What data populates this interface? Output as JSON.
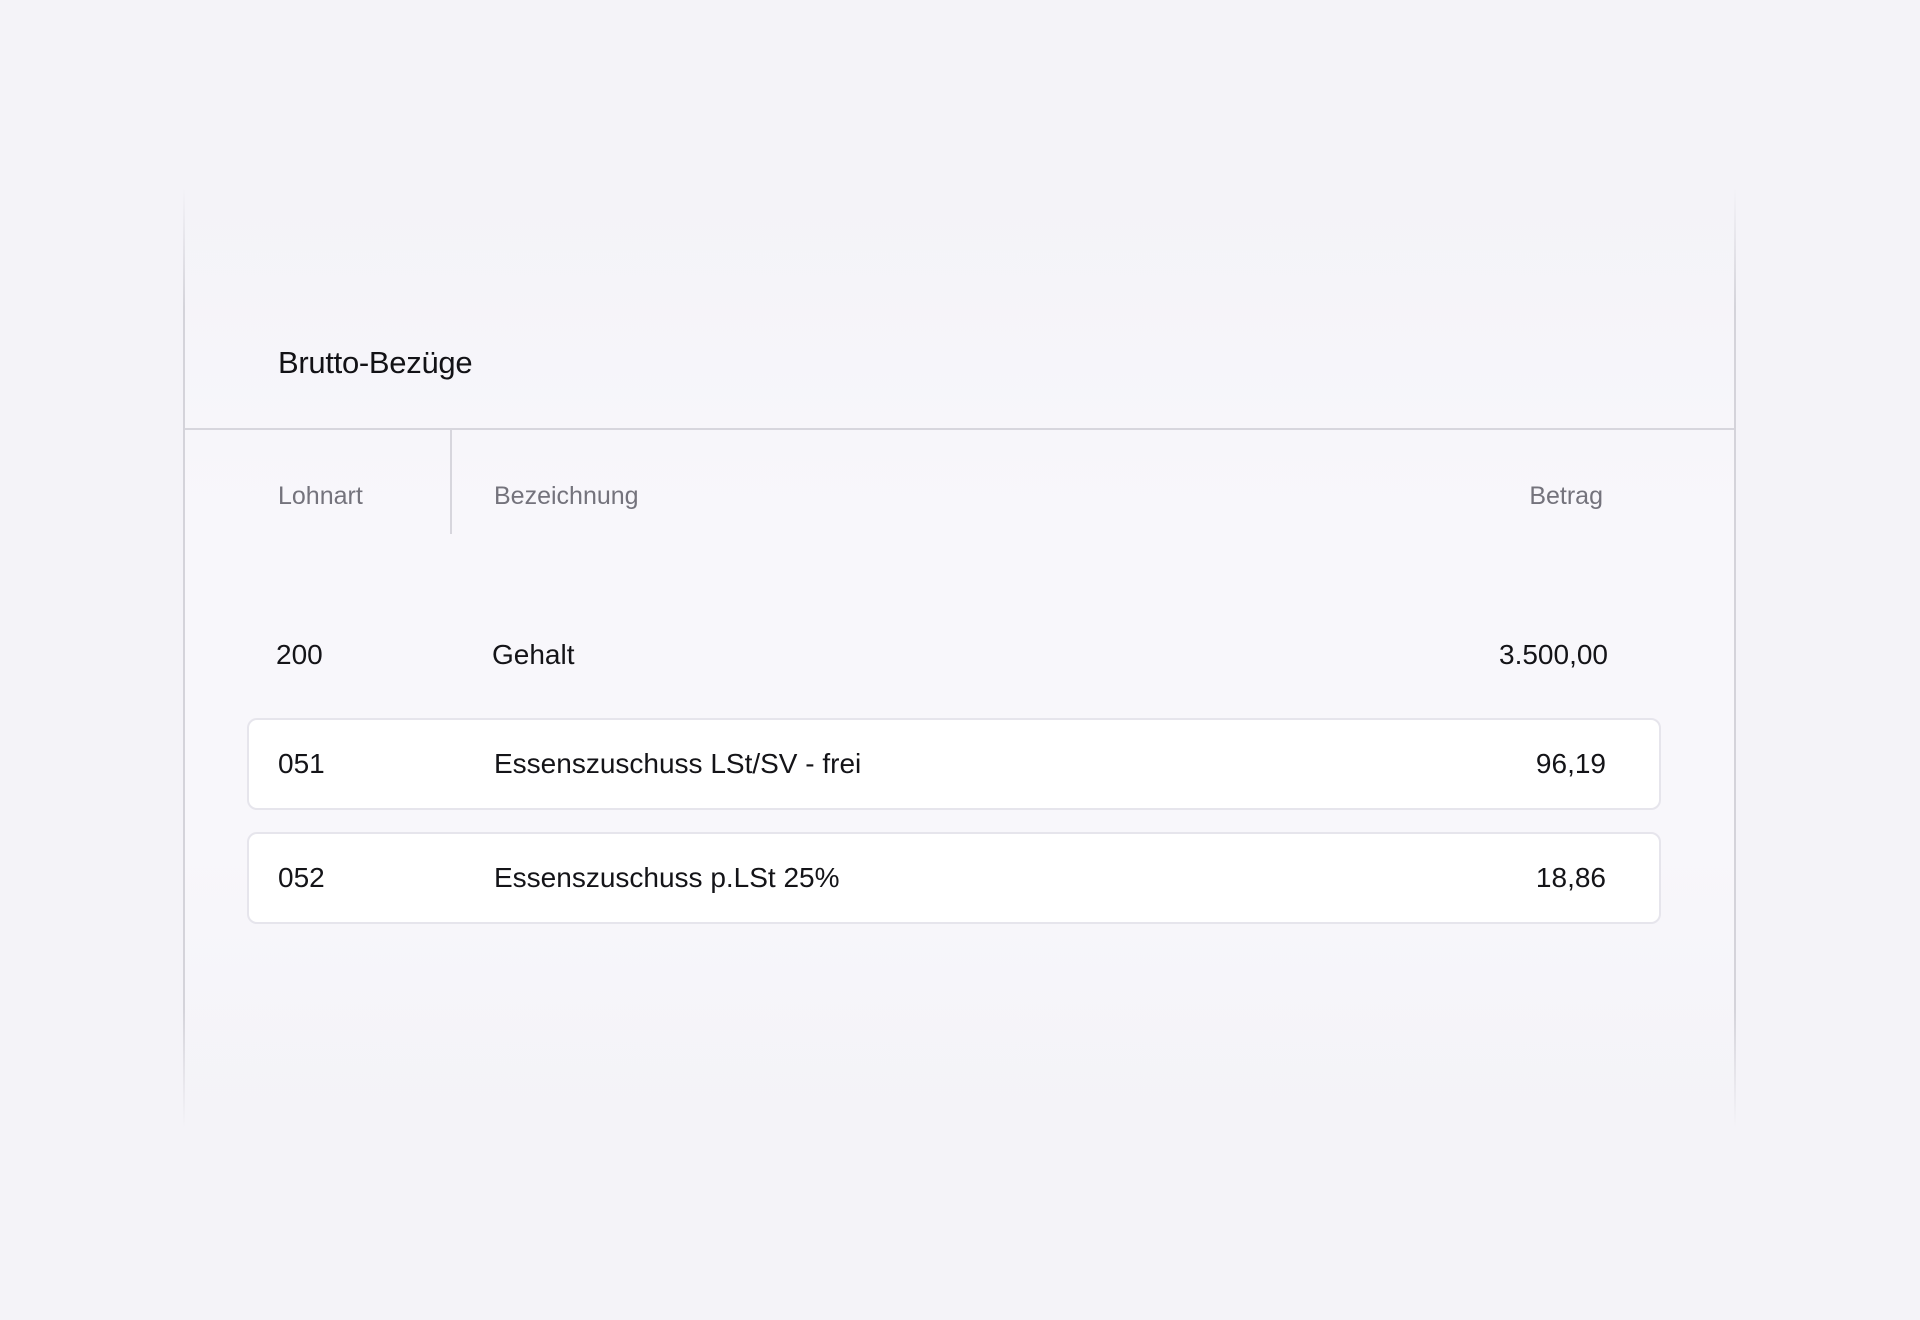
{
  "section": {
    "title": "Brutto-Bezüge"
  },
  "table": {
    "columns": {
      "lohnart": "Lohnart",
      "bezeichnung": "Bezeichnung",
      "betrag": "Betrag"
    },
    "rows": [
      {
        "code": "200",
        "name": "Gehalt",
        "amount": "3.500,00"
      },
      {
        "code": "051",
        "name": "Essenszuschuss LSt/SV - frei",
        "amount": "96,19"
      },
      {
        "code": "052",
        "name": "Essenszuschuss p.LSt 25%",
        "amount": "18,86"
      }
    ]
  }
}
